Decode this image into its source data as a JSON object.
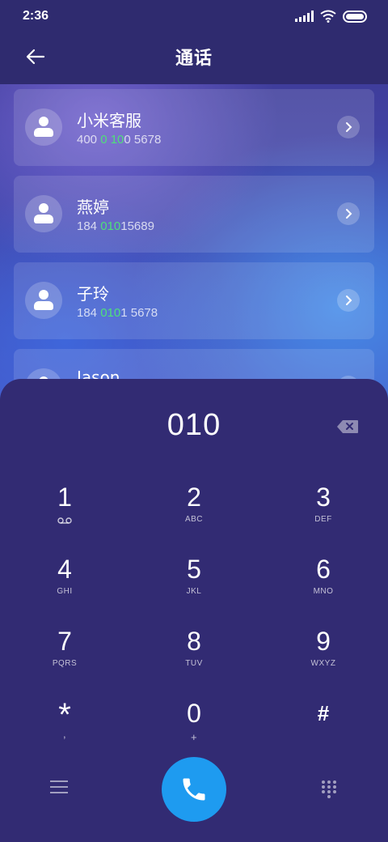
{
  "status_bar": {
    "time": "2:36"
  },
  "header": {
    "title": "通话"
  },
  "contacts": [
    {
      "name": "小米客服",
      "number_parts": [
        "400 ",
        "0",
        " ",
        "10",
        "0 5678"
      ]
    },
    {
      "name": "燕婷",
      "number_parts": [
        "184 ",
        "010",
        "15689"
      ]
    },
    {
      "name": "子玲",
      "number_parts": [
        "184 ",
        "010",
        "1 5678"
      ]
    },
    {
      "name": "Jason"
    }
  ],
  "dialer": {
    "display_value": "010",
    "keys": [
      {
        "digit": "1",
        "letters": ""
      },
      {
        "digit": "2",
        "letters": "ABC"
      },
      {
        "digit": "3",
        "letters": "DEF"
      },
      {
        "digit": "4",
        "letters": "GHI"
      },
      {
        "digit": "5",
        "letters": "JKL"
      },
      {
        "digit": "6",
        "letters": "MNO"
      },
      {
        "digit": "7",
        "letters": "PQRS"
      },
      {
        "digit": "8",
        "letters": "TUV"
      },
      {
        "digit": "9",
        "letters": "WXYZ"
      },
      {
        "digit": "*",
        "letters": ","
      },
      {
        "digit": "0",
        "letters": "+"
      },
      {
        "digit": "#",
        "letters": ""
      }
    ]
  },
  "icons": {
    "back": "arrow-left-icon",
    "chevron": "chevron-right-icon",
    "avatar": "person-icon",
    "backspace": "backspace-icon",
    "voicemail": "voicemail-icon",
    "menu": "menu-icon",
    "call": "phone-icon",
    "dialpad": "dialpad-icon"
  },
  "colors": {
    "highlight": "#4fe07a",
    "call_button": "#1e9bf0",
    "dialer_background": "#322b73"
  }
}
